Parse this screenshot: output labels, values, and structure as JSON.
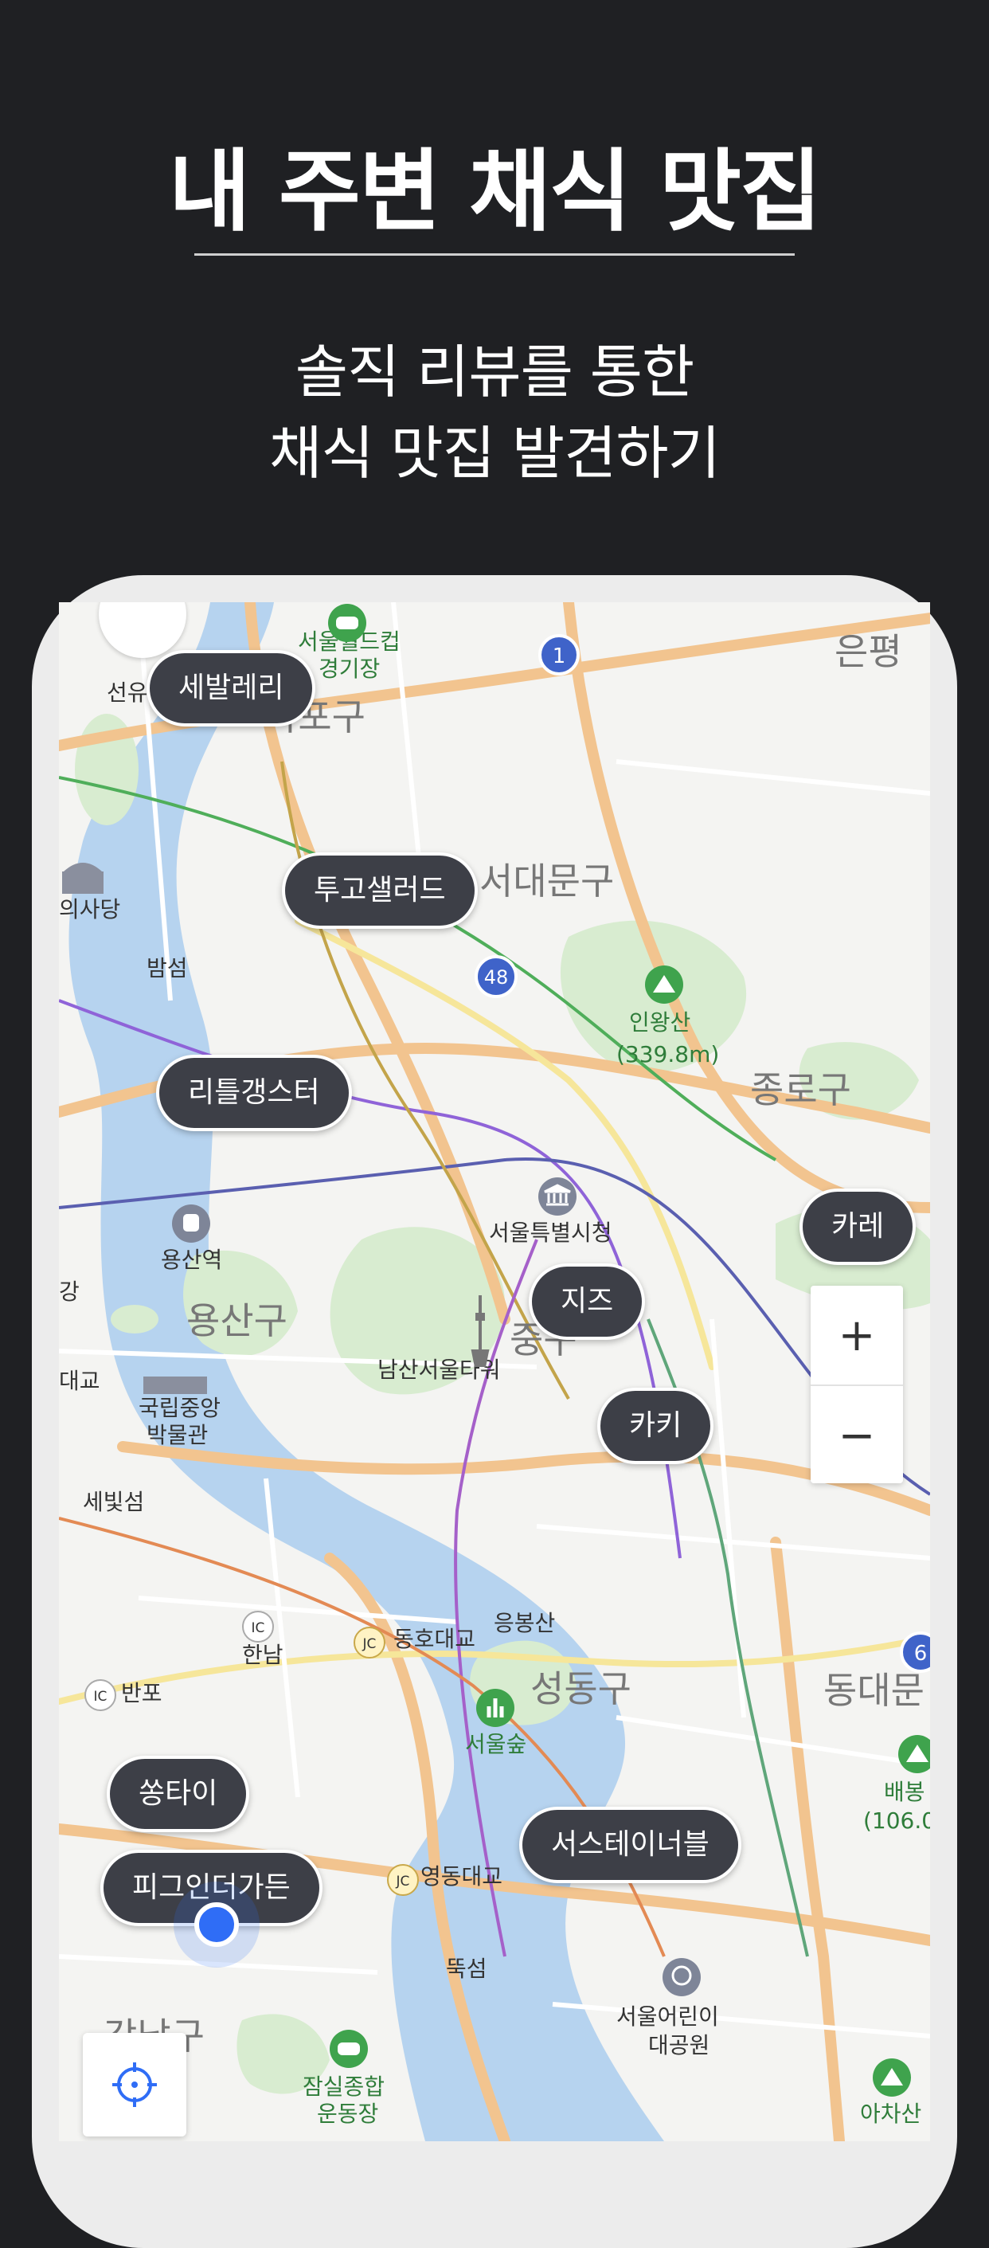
{
  "promo": {
    "title": "내 주변 채식 맛집",
    "subtitle_line1": "솔직 리뷰를 통한",
    "subtitle_line2": "채식 맛집 발견하기"
  },
  "map": {
    "districts": [
      "서대문구",
      "종로구",
      "용산구",
      "중구",
      "성동구",
      "강남구",
      "동대문",
      "은평",
      "마포구"
    ],
    "places": [
      "서울월드컵",
      "경기장",
      "선유",
      "의사당",
      "밤섬",
      "인왕산",
      "(339.8m)",
      "용산역",
      "서울특별시청",
      "남산서울타워",
      "국립중앙",
      "박물관",
      "세빛섬",
      "한남",
      "반포",
      "동호대교",
      "응봉산",
      "서울숲",
      "배봉",
      "(106.0",
      "영동대교",
      "뚝섬",
      "서울어린이",
      "대공원",
      "잠실종합",
      "운동장",
      "아차산",
      "강",
      "대교"
    ],
    "road_badges": [
      "1",
      "48",
      "6"
    ],
    "interchange_badges": [
      "IC",
      "IC",
      "JC",
      "JC"
    ],
    "restaurants": [
      "세발레리",
      "투고샐러드",
      "리틀갱스터",
      "카레",
      "지즈",
      "카키",
      "쏭타이",
      "피그인더가든",
      "서스테이너블"
    ],
    "zoom_in_label": "+",
    "zoom_out_label": "−"
  },
  "colors": {
    "background": "#1f2023",
    "pin_bg": "#3d3f47",
    "river": "#b6d3ef",
    "park": "#d8ecd0",
    "major_road": "#f2c48f",
    "location_dot": "#2f6df6"
  }
}
